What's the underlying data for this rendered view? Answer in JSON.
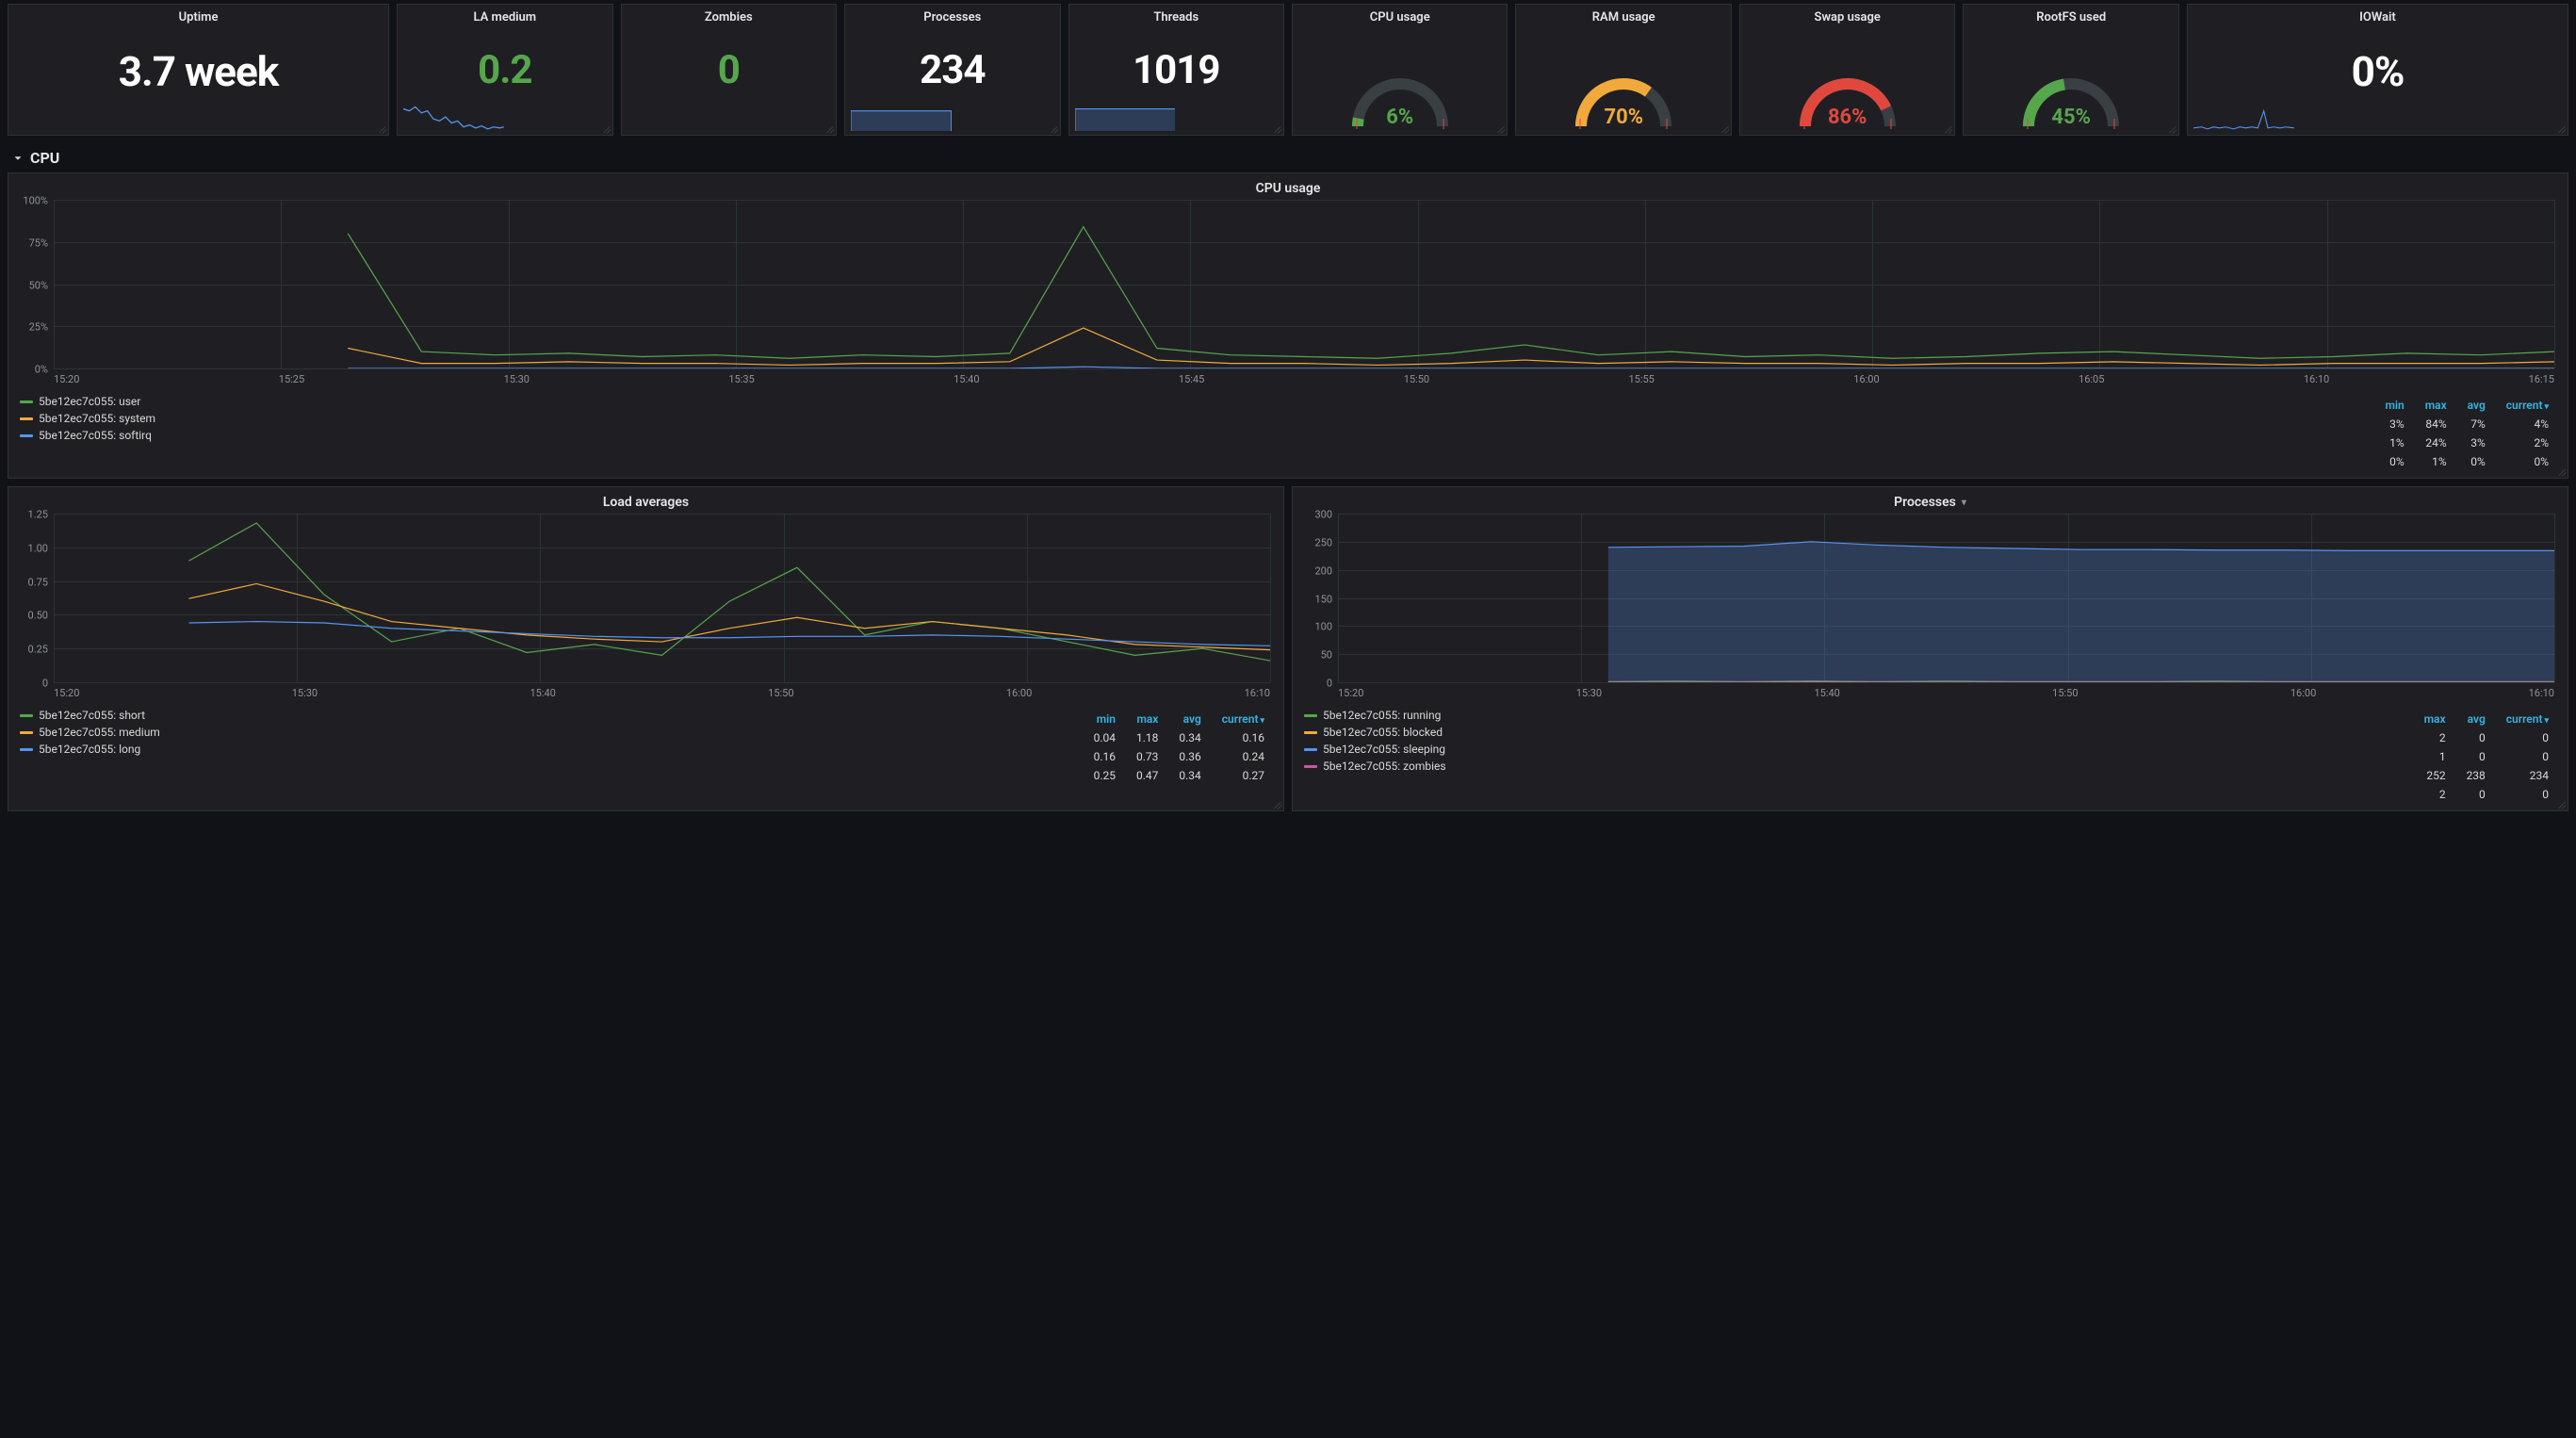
{
  "colors": {
    "green": "#56a64b",
    "orange": "#f2a93b",
    "red": "#e0483e",
    "cyan": "#5794f2",
    "magenta": "#c15c9e",
    "label_blue": "#33b5e5"
  },
  "stats": {
    "uptime": {
      "title": "Uptime",
      "value": "3.7 week"
    },
    "la": {
      "title": "LA medium",
      "value": "0.2"
    },
    "zombies": {
      "title": "Zombies",
      "value": "0"
    },
    "processes": {
      "title": "Processes",
      "value": "234"
    },
    "threads": {
      "title": "Threads",
      "value": "1019"
    },
    "cpu": {
      "title": "CPU usage",
      "value": "6%",
      "pct": 6,
      "color": "green"
    },
    "ram": {
      "title": "RAM usage",
      "value": "70%",
      "pct": 70,
      "color": "orange"
    },
    "swap": {
      "title": "Swap usage",
      "value": "86%",
      "pct": 86,
      "color": "red"
    },
    "rootfs": {
      "title": "RootFS used",
      "value": "45%",
      "pct": 45,
      "color": "green"
    },
    "iowait": {
      "title": "IOWait",
      "value": "0%"
    }
  },
  "section_cpu_label": "CPU",
  "chart_data": [
    {
      "id": "cpu_usage",
      "type": "line",
      "title": "CPU usage",
      "xlabel": "",
      "ylabel": "",
      "ylim": [
        0,
        100
      ],
      "yticks": [
        "0%",
        "25%",
        "50%",
        "75%",
        "100%"
      ],
      "xticks": [
        "15:20",
        "15:25",
        "15:30",
        "15:35",
        "15:40",
        "15:45",
        "15:50",
        "15:55",
        "16:00",
        "16:05",
        "16:10",
        "16:15"
      ],
      "series": [
        {
          "name": "5be12ec7c055: user",
          "color": "green",
          "values": [
            null,
            null,
            null,
            null,
            80,
            10,
            8,
            9,
            7,
            8,
            6,
            8,
            7,
            9,
            84,
            12,
            8,
            7,
            6,
            9,
            14,
            8,
            10,
            7,
            8,
            6,
            7,
            9,
            10,
            8,
            6,
            7,
            9,
            8,
            10
          ]
        },
        {
          "name": "5be12ec7c055: system",
          "color": "orange",
          "values": [
            null,
            null,
            null,
            null,
            12,
            3,
            3,
            4,
            3,
            3,
            2,
            3,
            3,
            4,
            24,
            5,
            3,
            3,
            2,
            3,
            5,
            3,
            4,
            3,
            3,
            2,
            3,
            3,
            4,
            3,
            2,
            3,
            3,
            3,
            4
          ]
        },
        {
          "name": "5be12ec7c055: softirq",
          "color": "cyan",
          "values": [
            null,
            null,
            null,
            null,
            0,
            0,
            0,
            0,
            0,
            0,
            0,
            0,
            0,
            0,
            1,
            0,
            0,
            0,
            0,
            0,
            0,
            0,
            0,
            0,
            0,
            0,
            0,
            0,
            0,
            0,
            0,
            0,
            0,
            0,
            0
          ]
        }
      ],
      "legend_table": {
        "cols": [
          "min",
          "max",
          "avg",
          "current"
        ],
        "sort": "current",
        "rows": [
          [
            "3%",
            "84%",
            "7%",
            "4%"
          ],
          [
            "1%",
            "24%",
            "3%",
            "2%"
          ],
          [
            "0%",
            "1%",
            "0%",
            "0%"
          ]
        ]
      }
    },
    {
      "id": "load_avg",
      "type": "line",
      "title": "Load averages",
      "ylim": [
        0,
        1.25
      ],
      "yticks": [
        "0",
        "0.25",
        "0.50",
        "0.75",
        "1.00",
        "1.25"
      ],
      "xticks": [
        "15:20",
        "15:30",
        "15:40",
        "15:50",
        "16:00",
        "16:10"
      ],
      "series": [
        {
          "name": "5be12ec7c055: short",
          "color": "green",
          "values": [
            null,
            null,
            0.9,
            1.18,
            0.65,
            0.3,
            0.4,
            0.22,
            0.28,
            0.2,
            0.6,
            0.85,
            0.35,
            0.45,
            0.4,
            0.3,
            0.2,
            0.25,
            0.16
          ]
        },
        {
          "name": "5be12ec7c055: medium",
          "color": "orange",
          "values": [
            null,
            null,
            0.62,
            0.73,
            0.6,
            0.45,
            0.4,
            0.35,
            0.32,
            0.3,
            0.4,
            0.48,
            0.4,
            0.45,
            0.4,
            0.35,
            0.28,
            0.26,
            0.24
          ]
        },
        {
          "name": "5be12ec7c055: long",
          "color": "cyan",
          "values": [
            null,
            null,
            0.44,
            0.45,
            0.44,
            0.4,
            0.38,
            0.36,
            0.34,
            0.33,
            0.33,
            0.34,
            0.34,
            0.35,
            0.34,
            0.32,
            0.3,
            0.28,
            0.27
          ]
        }
      ],
      "legend_table": {
        "cols": [
          "min",
          "max",
          "avg",
          "current"
        ],
        "sort": "current",
        "rows": [
          [
            "0.04",
            "1.18",
            "0.34",
            "0.16"
          ],
          [
            "0.16",
            "0.73",
            "0.36",
            "0.24"
          ],
          [
            "0.25",
            "0.47",
            "0.34",
            "0.27"
          ]
        ]
      }
    },
    {
      "id": "processes",
      "type": "area",
      "title": "Processes",
      "title_has_menu": true,
      "ylim": [
        0,
        300
      ],
      "yticks": [
        "0",
        "50",
        "100",
        "150",
        "200",
        "250",
        "300"
      ],
      "xticks": [
        "15:20",
        "15:30",
        "15:40",
        "15:50",
        "16:00",
        "16:10"
      ],
      "series": [
        {
          "name": "5be12ec7c055: running",
          "color": "green",
          "values": [
            null,
            null,
            null,
            null,
            1,
            2,
            1,
            2,
            1,
            2,
            1,
            1,
            1,
            2,
            1,
            1,
            1,
            1,
            1
          ]
        },
        {
          "name": "5be12ec7c055: blocked",
          "color": "orange",
          "values": [
            null,
            null,
            null,
            null,
            0,
            0,
            0,
            1,
            0,
            0,
            0,
            0,
            0,
            0,
            0,
            0,
            0,
            0,
            0
          ]
        },
        {
          "name": "5be12ec7c055: sleeping",
          "color": "cyan",
          "values": [
            null,
            null,
            null,
            null,
            240,
            241,
            242,
            250,
            244,
            240,
            238,
            236,
            236,
            235,
            235,
            234,
            234,
            234,
            234
          ]
        },
        {
          "name": "5be12ec7c055: zombies",
          "color": "magenta",
          "values": [
            null,
            null,
            null,
            null,
            0,
            0,
            0,
            0,
            0,
            0,
            0,
            0,
            0,
            0,
            0,
            0,
            0,
            0,
            0
          ]
        }
      ],
      "legend_table": {
        "cols": [
          "max",
          "avg",
          "current"
        ],
        "sort": "current",
        "rows": [
          [
            "2",
            "0",
            "0"
          ],
          [
            "1",
            "0",
            "0"
          ],
          [
            "252",
            "238",
            "234"
          ],
          [
            "2",
            "0",
            "0"
          ]
        ]
      }
    }
  ]
}
